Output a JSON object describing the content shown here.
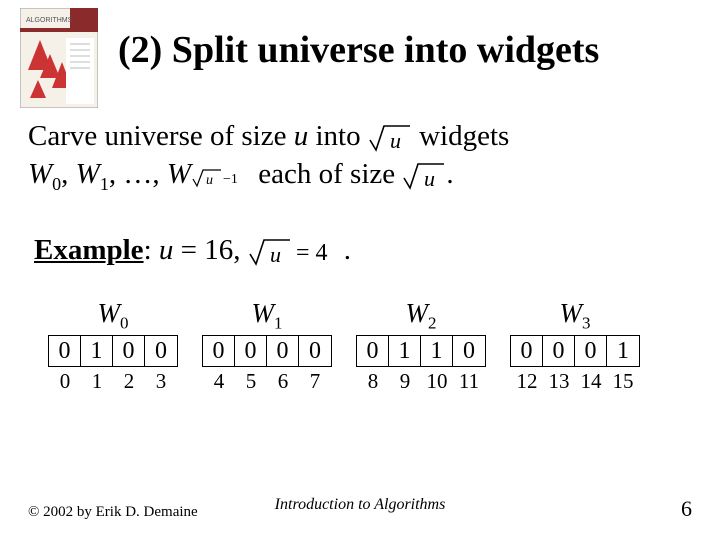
{
  "title": "(2) Split universe into widgets",
  "body": {
    "line1_a": "Carve universe of size ",
    "u1": "u",
    "line1_b": " into ",
    "sqrt_u_1_alt": "√u",
    "line1_c": " widgets",
    "line2_a": "W",
    "sub0": "0",
    "comma1": ", ",
    "w1": "W",
    "sub1": "1",
    "comma2": ", …, ",
    "w_last": "W",
    "sub_last_alt": "√u −1",
    "line2_b": " each of size ",
    "sqrt_u_2_alt": "√u",
    "period": "."
  },
  "example": {
    "label": "Example",
    "colon": ": ",
    "u": "u",
    "eq": " = 16, ",
    "sqrt_expr_alt": "√u = 4",
    "period": "."
  },
  "widgets": [
    {
      "label": "W",
      "sub": "0",
      "cells": [
        "0",
        "1",
        "0",
        "0"
      ],
      "indices": [
        "0",
        "1",
        "2",
        "3"
      ]
    },
    {
      "label": "W",
      "sub": "1",
      "cells": [
        "0",
        "0",
        "0",
        "0"
      ],
      "indices": [
        "4",
        "5",
        "6",
        "7"
      ]
    },
    {
      "label": "W",
      "sub": "2",
      "cells": [
        "0",
        "1",
        "1",
        "0"
      ],
      "indices": [
        "8",
        "9",
        "10",
        "11"
      ]
    },
    {
      "label": "W",
      "sub": "3",
      "cells": [
        "0",
        "0",
        "0",
        "1"
      ],
      "indices": [
        "12",
        "13",
        "14",
        "15"
      ]
    }
  ],
  "footer": {
    "copyright": "© 2002 by Erik D. Demaine",
    "center": "Introduction to Algorithms",
    "page": "6"
  }
}
